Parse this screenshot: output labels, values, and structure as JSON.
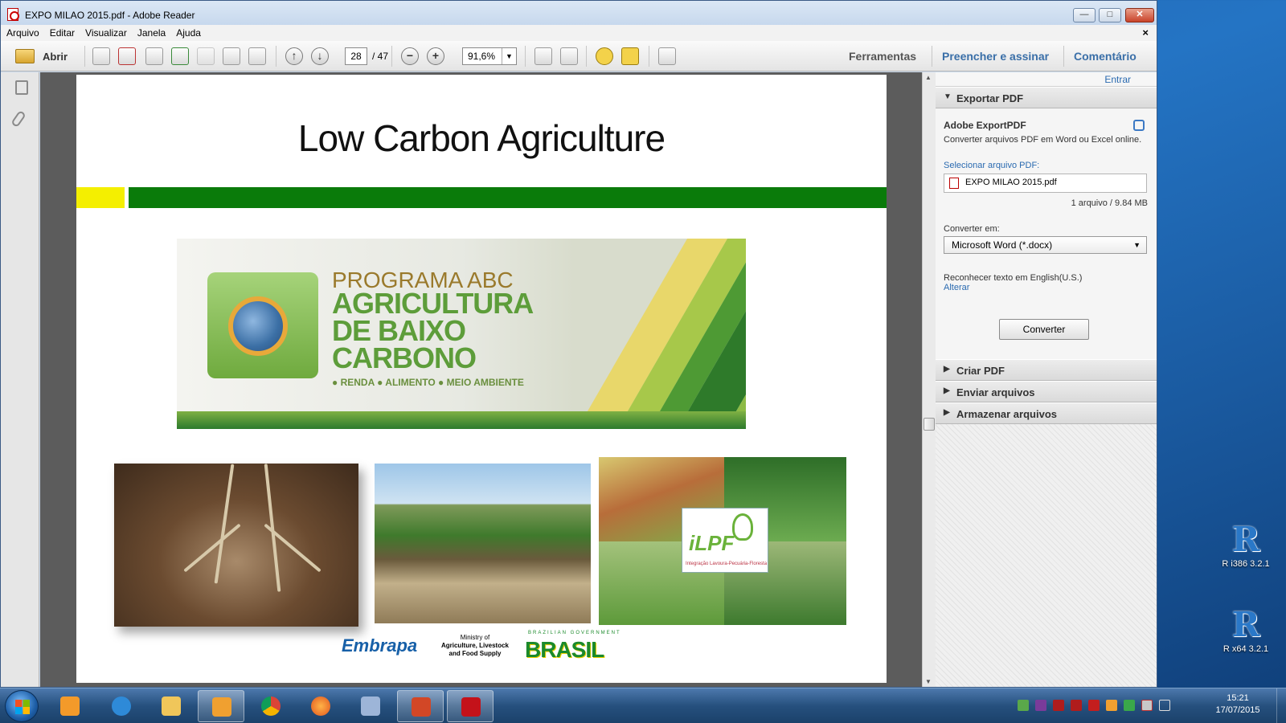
{
  "window": {
    "title": "EXPO MILAO 2015.pdf - Adobe Reader",
    "controls": {
      "minimize": "—",
      "maximize": "□",
      "close": "✕"
    }
  },
  "menu": {
    "items": [
      "Arquivo",
      "Editar",
      "Visualizar",
      "Janela",
      "Ajuda"
    ],
    "close": "×"
  },
  "toolbar": {
    "open_label": "Abrir",
    "page_current": "28",
    "page_total": "/ 47",
    "zoom": "91,6%",
    "tools_label": "Ferramentas",
    "fill_sign_label": "Preencher e assinar",
    "comment_label": "Comentário"
  },
  "document": {
    "slide_title": "Low Carbon Agriculture",
    "banner": {
      "line1": "PROGRAMA ABC",
      "line2": "AGRICULTURA",
      "line3": "DE BAIXO",
      "line4": "CARBONO",
      "tagline": "● RENDA  ● ALIMENTO  ● MEIO AMBIENTE"
    },
    "ilpf": {
      "logo": "iLPF",
      "subtitle": "Integração Lavoura-Pecuária-Floresta"
    },
    "logos": {
      "embrapa": "Embrapa",
      "ministry_line1": "Ministry of",
      "ministry_line2": "Agriculture, Livestock",
      "ministry_line3": "and Food Supply",
      "brasil_top": "BRAZILIAN GOVERNMENT",
      "brasil": "BRASIL"
    }
  },
  "right_panel": {
    "sign_in": "Entrar",
    "export_header": "Exportar PDF",
    "service_title": "Adobe ExportPDF",
    "service_desc": "Converter arquivos PDF em Word ou Excel online.",
    "select_label": "Selecionar arquivo PDF:",
    "file_name": "EXPO MILAO 2015.pdf",
    "file_info": "1 arquivo / 9.84 MB",
    "convert_to_label": "Converter em:",
    "convert_to_value": "Microsoft Word (*.docx)",
    "ocr_text": "Reconhecer texto em English(U.S.)",
    "ocr_change": "Alterar",
    "convert_button": "Converter",
    "sections": [
      "Criar PDF",
      "Enviar arquivos",
      "Armazenar arquivos"
    ]
  },
  "desktop_icons": [
    {
      "label": "R i386 3.2.1",
      "glyph": "R"
    },
    {
      "label": "R x64 3.2.1",
      "glyph": "R"
    }
  ],
  "taskbar": {
    "clock_time": "15:21",
    "clock_date": "17/07/2015"
  },
  "colors": {
    "slide_green": "#0a7b0a",
    "slide_yellow": "#f4ef00",
    "link_blue": "#2a6ab0"
  }
}
